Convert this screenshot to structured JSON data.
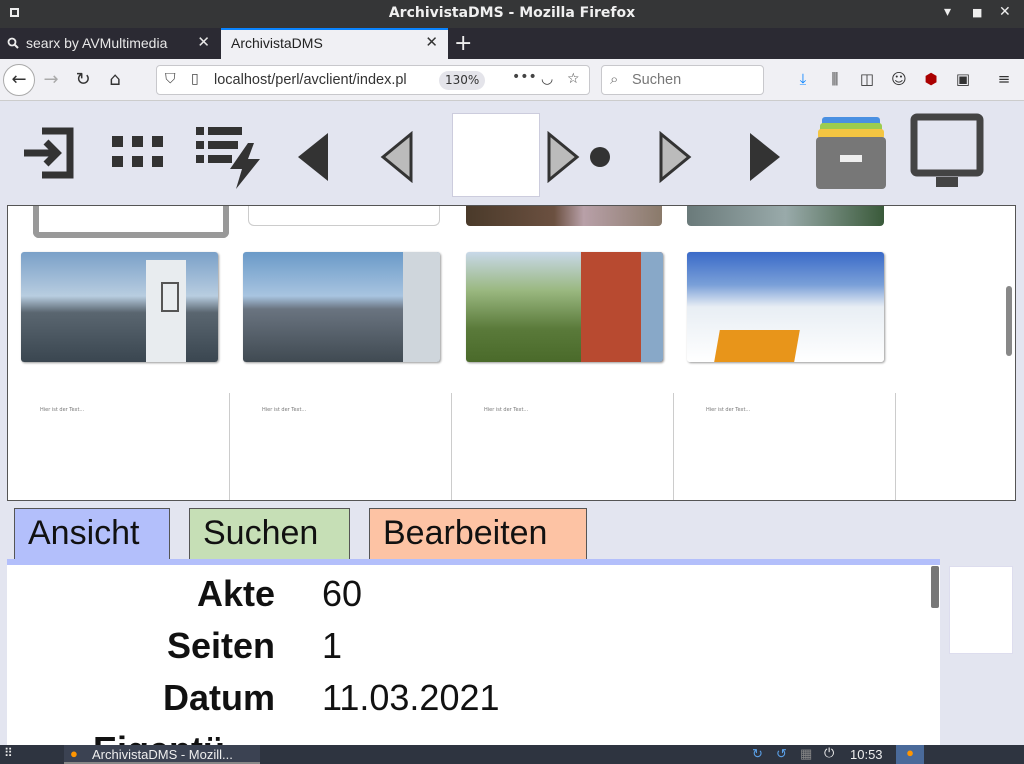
{
  "window": {
    "title": "ArchivistaDMS - Mozilla Firefox"
  },
  "tabs": [
    {
      "label": "searx by AVMultimedia",
      "active": false
    },
    {
      "label": "ArchivistaDMS",
      "active": true
    }
  ],
  "navbar": {
    "url": "localhost/perl/avclient/index.pl",
    "zoom": "130%",
    "search_placeholder": "Suchen"
  },
  "apptabs": {
    "ansicht": "Ansicht",
    "suchen": "Suchen",
    "bearbeiten": "Bearbeiten"
  },
  "details": [
    {
      "key": "Akte",
      "value": "60"
    },
    {
      "key": "Seiten",
      "value": "1"
    },
    {
      "key": "Datum",
      "value": "11.03.2021"
    },
    {
      "key": "Eigentü",
      "value": ""
    }
  ],
  "doc_thumbs": [
    "Hier ist der Text...",
    "Hier ist der Text...",
    "Hier ist der Text...",
    "Hier ist der Text..."
  ],
  "taskbar": {
    "app_label": "ArchivistaDMS - Mozill...",
    "clock": "10:53"
  },
  "colors": {
    "ansicht": "#b3bffb",
    "suchen": "#c6dfb6",
    "bearbeiten": "#fdc3a4"
  }
}
